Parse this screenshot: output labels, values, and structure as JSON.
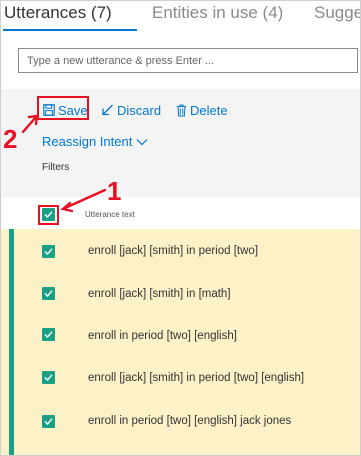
{
  "tabs": [
    {
      "label": "Utterances (7)",
      "active": true
    },
    {
      "label": "Entities in use (4)",
      "active": false
    },
    {
      "label": "Sugge",
      "active": false
    }
  ],
  "utterance_input": {
    "placeholder": "Type a new utterance & press Enter ...",
    "value": ""
  },
  "toolbar": {
    "save_label": "Save",
    "discard_label": "Discard",
    "delete_label": "Delete",
    "reassign_label": "Reassign Intent",
    "filters_label": "Filters"
  },
  "table": {
    "column_header": "Utterance text",
    "header_checked": true,
    "rows": [
      {
        "text": "enroll [jack] [smith] in period [two]",
        "checked": true
      },
      {
        "text": "enroll [jack] [smith] in [math]",
        "checked": true
      },
      {
        "text": "enroll in period [two] [english]",
        "checked": true
      },
      {
        "text": "enroll [jack] [smith] in period [two] [english]",
        "checked": true
      },
      {
        "text": "enroll in period [two] [english] jack jones",
        "checked": true
      }
    ]
  },
  "annotations": {
    "marker_1": "1",
    "marker_2": "2"
  },
  "colors": {
    "accent_blue": "#0078d4",
    "check_green": "#1aa084",
    "annotation_red": "#e81123",
    "row_highlight": "#fdf1c8"
  },
  "icons": {
    "save": "floppy-disk-icon",
    "discard": "undo-arrow-icon",
    "delete": "trash-can-icon",
    "reassign": "chevron-down-icon",
    "check": "checkmark-icon"
  }
}
